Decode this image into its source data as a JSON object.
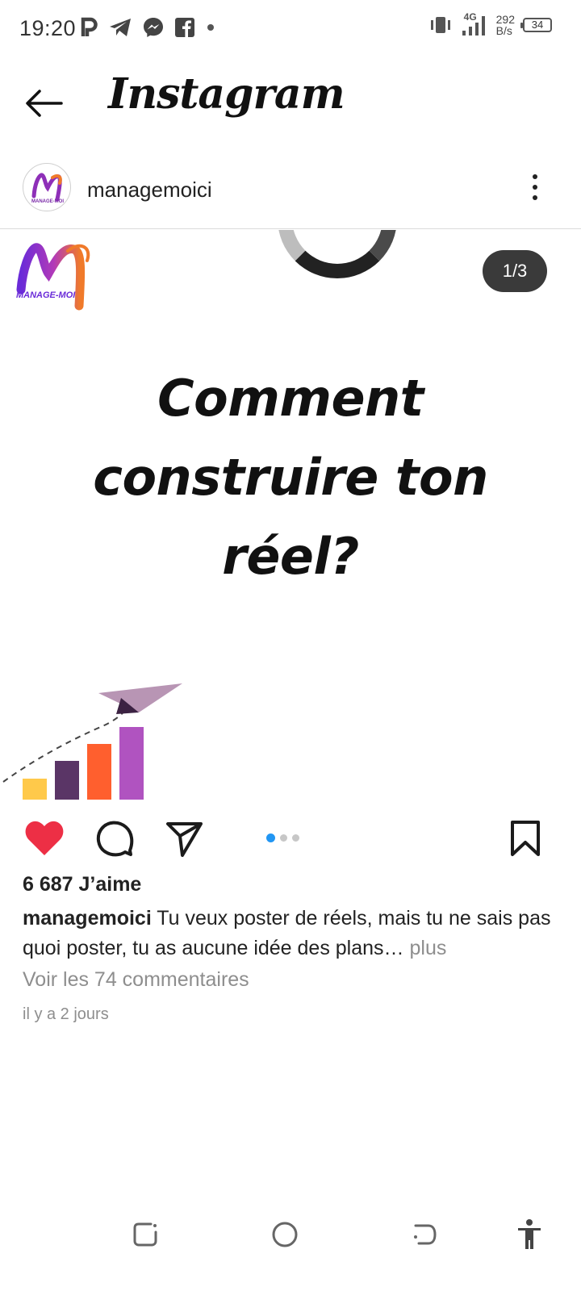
{
  "status_bar": {
    "time": "19:20",
    "network_type": "4G",
    "speed_value": "292",
    "speed_unit": "B/s",
    "battery": "34",
    "left_icons": [
      "parking-icon",
      "telegram-icon",
      "messenger-icon",
      "facebook-icon",
      "dot-icon"
    ],
    "right_icons": [
      "vibrate-icon",
      "signal-icon",
      "battery-icon"
    ]
  },
  "header": {
    "title": "Instagram",
    "back_icon": "arrow-left-icon"
  },
  "post": {
    "username": "managemoici",
    "avatar_text": "MANAGE-MOI",
    "image": {
      "logo_text": "MANAGE-MOI",
      "page_counter": "1/3",
      "headline": "Comment construire ton réel?",
      "bar_colors": [
        "#ffc94a",
        "#5a3566",
        "#ff5f2e",
        "#b053c0"
      ]
    },
    "carousel": {
      "count": 3,
      "active": 0
    },
    "likes": "6 687 J’aime",
    "caption_user": "managemoici",
    "caption_text": "Tu veux poster de réels, mais tu ne sais pas quoi poster, tu as aucune idée des plans…",
    "caption_more": "plus",
    "comments_link": "Voir les 74 commentaires",
    "timestamp": "il y a 2 jours"
  },
  "actions": {
    "like_icon": "heart-filled-icon",
    "comment_icon": "comment-icon",
    "share_icon": "send-icon",
    "save_icon": "bookmark-icon"
  },
  "colors": {
    "like_red": "#ed2f45",
    "dot_active": "#2196f3",
    "dot_inactive": "#c7c7c7",
    "brand_purple": "#8e2fb8",
    "brand_orange": "#f07a2a",
    "muted_text": "#8e8e8e"
  },
  "nav_bar": {
    "icons": [
      "recent-apps-icon",
      "home-icon",
      "back-icon",
      "accessibility-icon"
    ]
  }
}
